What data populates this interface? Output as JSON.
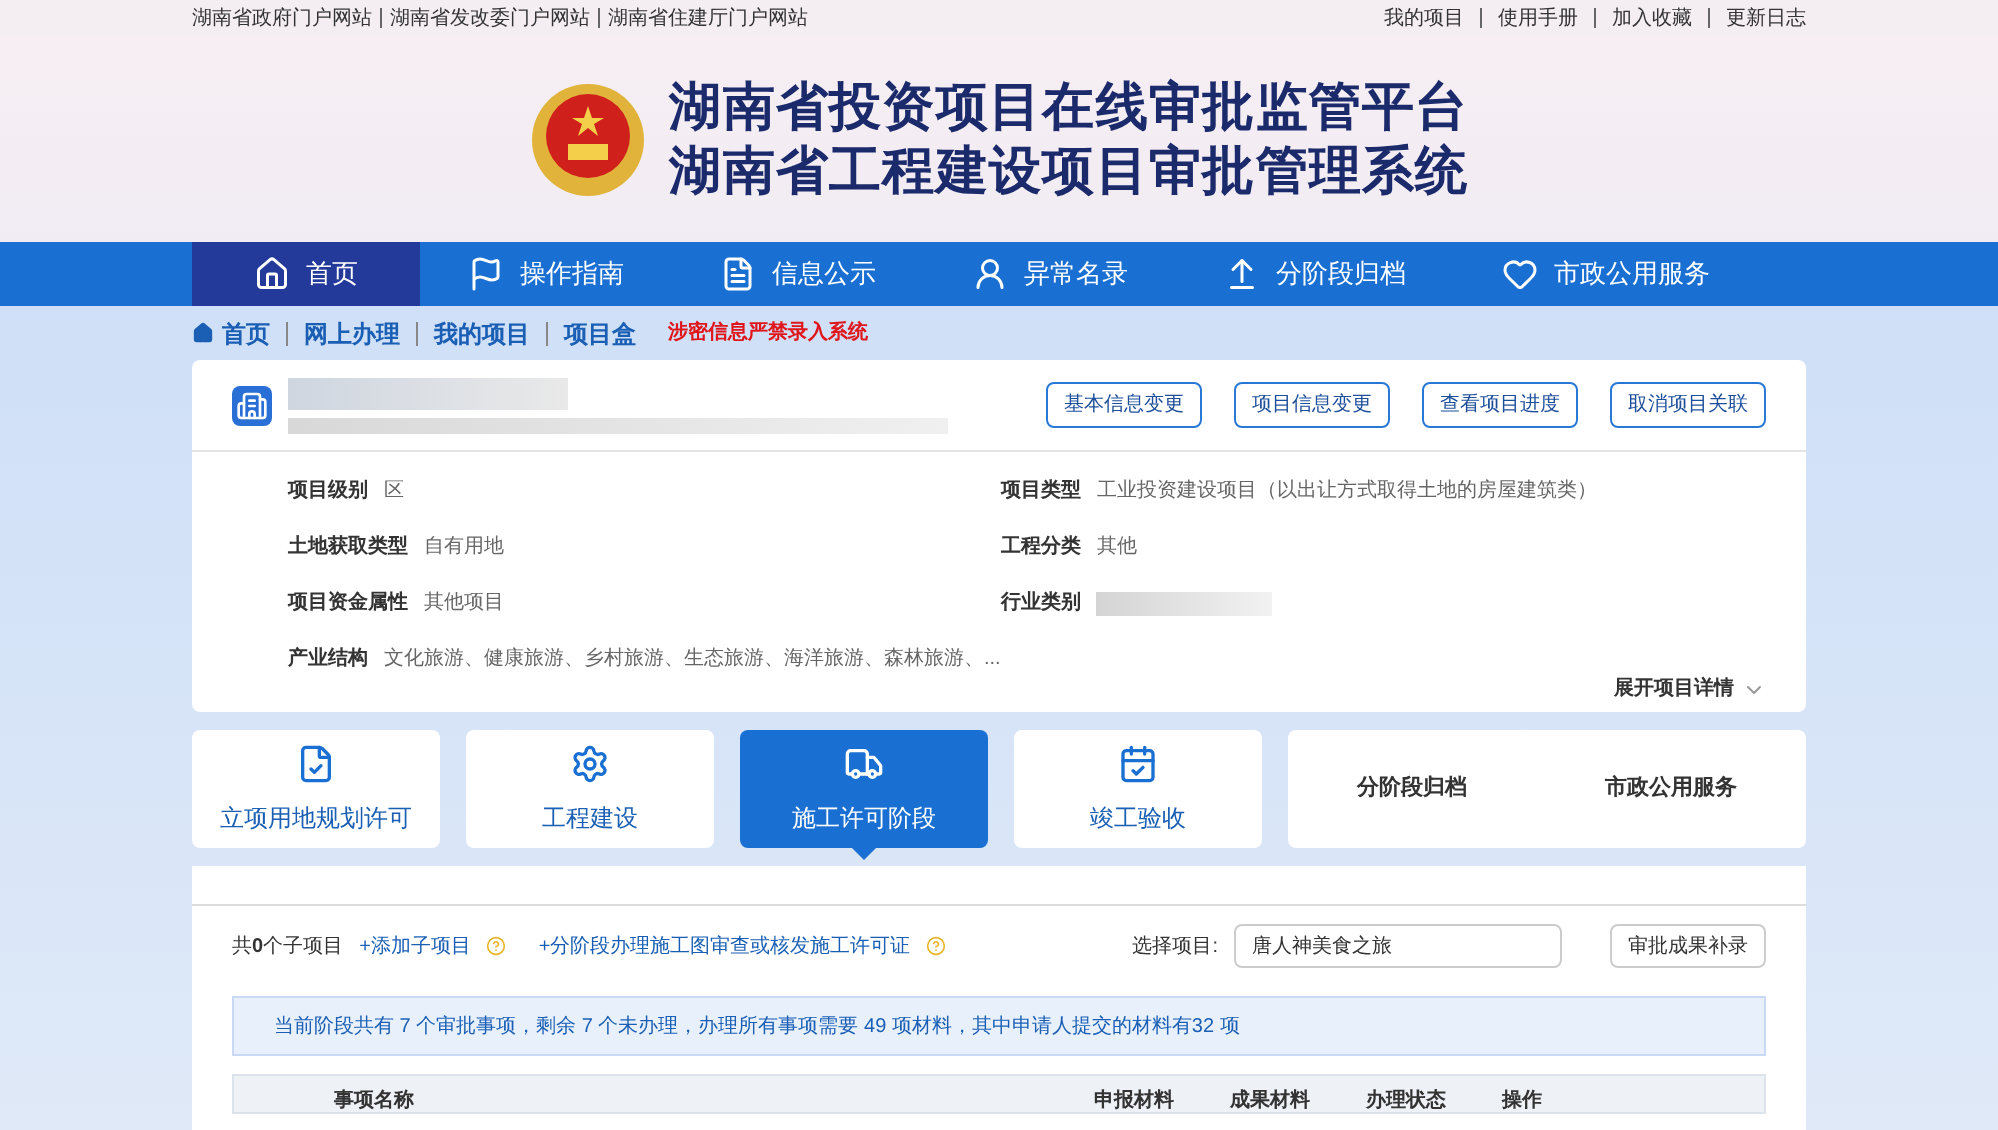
{
  "top_links": {
    "left": [
      "湖南省政府门户网站",
      "湖南省发改委门户网站",
      "湖南省住建厅门户网站"
    ],
    "right": [
      "我的项目",
      "使用手册",
      "加入收藏",
      "更新日志"
    ]
  },
  "header": {
    "title_1": "湖南省投资项目在线审批监管平台",
    "title_2": "湖南省工程建设项目审批管理系统"
  },
  "nav": [
    {
      "label": "首页",
      "selected": true
    },
    {
      "label": "操作指南",
      "selected": false
    },
    {
      "label": "信息公示",
      "selected": false
    },
    {
      "label": "异常名录",
      "selected": false
    },
    {
      "label": "分阶段归档",
      "selected": false
    },
    {
      "label": "市政公用服务",
      "selected": false
    }
  ],
  "breadcrumb": {
    "items": [
      "首页",
      "网上办理",
      "我的项目",
      "项目盒"
    ],
    "warning": "涉密信息严禁录入系统"
  },
  "project": {
    "actions": [
      "基本信息变更",
      "项目信息变更",
      "查看项目进度",
      "取消项目关联"
    ],
    "fields_left": [
      {
        "label": "项目级别",
        "value": "区"
      },
      {
        "label": "土地获取类型",
        "value": "自有用地"
      },
      {
        "label": "项目资金属性",
        "value": "其他项目"
      },
      {
        "label": "产业结构",
        "value": "文化旅游、健康旅游、乡村旅游、生态旅游、海洋旅游、森林旅游、..."
      }
    ],
    "fields_right": [
      {
        "label": "项目类型",
        "value": "工业投资建设项目（以出让方式取得土地的房屋建筑类）"
      },
      {
        "label": "工程分类",
        "value": "其他"
      },
      {
        "label": "行业类别"
      }
    ],
    "expand": "展开项目详情"
  },
  "stages": [
    {
      "label": "立项用地规划许可",
      "kind": "icon",
      "selected": false
    },
    {
      "label": "工程建设",
      "kind": "icon",
      "selected": false
    },
    {
      "label": "施工许可阶段",
      "kind": "icon",
      "selected": true
    },
    {
      "label": "竣工验收",
      "kind": "icon",
      "selected": false
    }
  ],
  "extra_stages": [
    "分阶段归档",
    "市政公用服务"
  ],
  "content": {
    "count": "共**0**个子项目",
    "add_link": "+添加子项目",
    "stage_link": "+分阶段办理施工图审查或核发施工许可证",
    "select_label": "选择项目:",
    "select_value": "唐人神美食之旅",
    "supplement_button": "审批成果补录",
    "notice": "当前阶段共有 7 个审批事项，剩余 7 个未办理，办理所有事项需要 49 项材料，其中申请人提交的材料有32 项",
    "columns": [
      "事项名称",
      "申报材料",
      "成果材料",
      "办理状态",
      "操作"
    ]
  }
}
